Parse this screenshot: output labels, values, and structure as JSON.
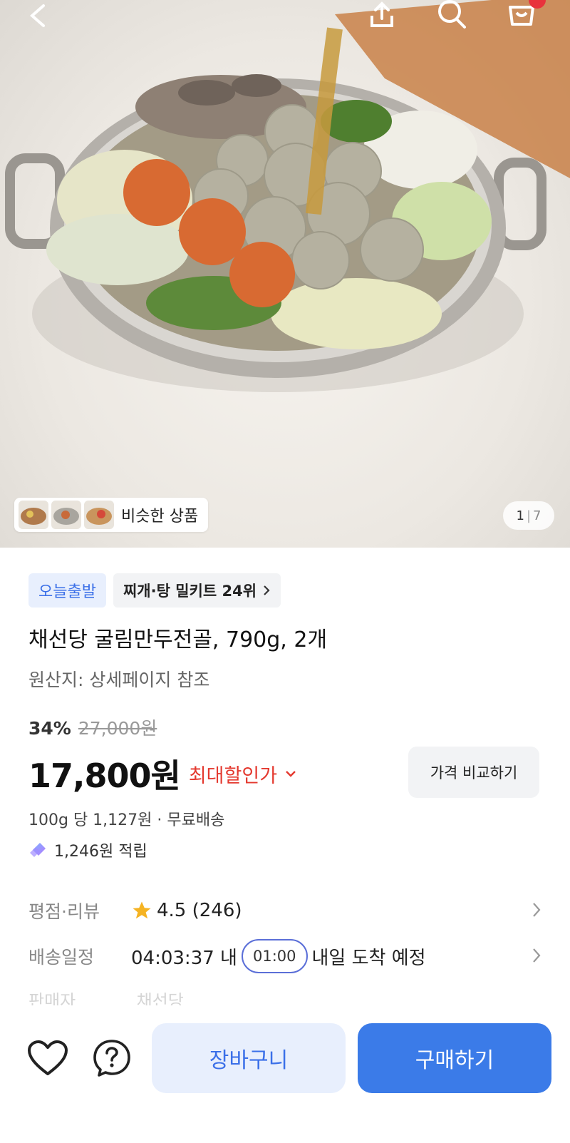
{
  "header": {
    "icons": [
      "back-icon",
      "share-icon",
      "search-icon",
      "cart-icon"
    ]
  },
  "gallery": {
    "similar_label": "비슷한 상품",
    "current": "1",
    "total": "7"
  },
  "badges": {
    "today": "오늘출발",
    "rank": "찌개·탕 밀키트 24위"
  },
  "product": {
    "title": "채선당 굴림만두전골, 790g, 2개",
    "origin": "원산지: 상세페이지 참조"
  },
  "pricing": {
    "discount": "34%",
    "original": "27,000원",
    "price": "17,800원",
    "max_discount_label": "최대할인가",
    "compare_label": "가격 비교하기",
    "unit_price": "100g 당 1,127원 · 무료배송",
    "points": "1,246원 적립"
  },
  "meta": {
    "rating_label": "평점·리뷰",
    "rating_value": "4.5 (246)",
    "delivery_label": "배송일정",
    "countdown": "04:03:37 내",
    "time_slot": "01:00",
    "delivery_text": "내일 도착 예정",
    "seller_label": "판매자",
    "seller_value": "채선당"
  },
  "actions": {
    "cart_label": "장바구니",
    "buy_label": "구매하기"
  },
  "colors": {
    "accent": "#3b7be8",
    "sale": "#e4392f",
    "star": "#f5b323"
  }
}
